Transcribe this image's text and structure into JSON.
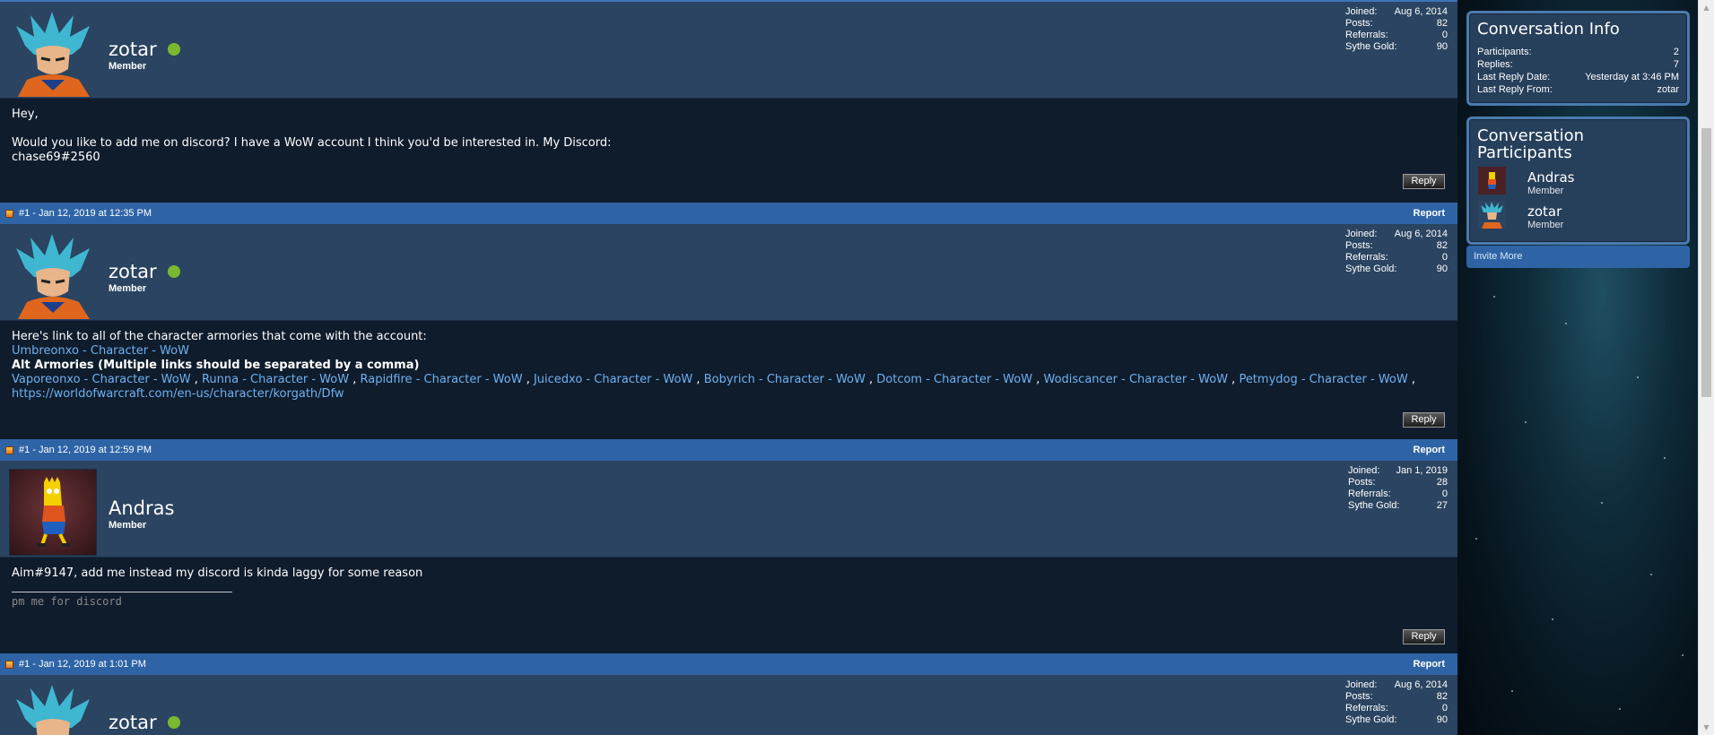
{
  "posts": [
    {
      "header": null,
      "username": "zotar",
      "online": true,
      "usertitle": "Member",
      "avatar": "goku-avatar",
      "stats": [
        {
          "label": "Joined:",
          "value": "Aug 6, 2014"
        },
        {
          "label": "Posts:",
          "value": "82"
        },
        {
          "label": "Referrals:",
          "value": "0"
        },
        {
          "label": "Sythe Gold:",
          "value": "90"
        }
      ],
      "body_lines": [
        "Hey,",
        "",
        "Would you like to add me on discord? I have a WoW account I think you'd be interested in. My Discord:",
        "chase69#2560"
      ],
      "reply_label": "Reply"
    },
    {
      "header": {
        "title": "#1 - Jan 12, 2019 at 12:35 PM",
        "report_label": "Report"
      },
      "username": "zotar",
      "online": true,
      "usertitle": "Member",
      "avatar": "goku-avatar",
      "stats": [
        {
          "label": "Joined:",
          "value": "Aug 6, 2014"
        },
        {
          "label": "Posts:",
          "value": "82"
        },
        {
          "label": "Referrals:",
          "value": "0"
        },
        {
          "label": "Sythe Gold:",
          "value": "90"
        }
      ],
      "intro": "Here's link to all of the character armories that come with the account:",
      "main_link": "Umbreonxo - Character - WoW",
      "alt_heading": "Alt Armories (Multiple links should be separated by a comma)",
      "alt_links": [
        "Vaporeonxo - Character - WoW",
        "Runna - Character - WoW",
        "Rapidfire - Character - WoW",
        "Juicedxo - Character - WoW",
        "Bobyrich - Character - WoW",
        "Dotcom - Character - WoW",
        "Wodiscancer - Character - WoW",
        "Petmydog - Character - WoW",
        "https://worldofwarcraft.com/en-us/character/korgath/Dfw"
      ],
      "separator": " , ",
      "reply_label": "Reply"
    },
    {
      "header": {
        "title": "#1 - Jan 12, 2019 at 12:59 PM",
        "report_label": "Report"
      },
      "username": "Andras",
      "online": false,
      "usertitle": "Member",
      "avatar": "bart-avatar",
      "stats": [
        {
          "label": "Joined:",
          "value": "Jan 1, 2019"
        },
        {
          "label": "Posts:",
          "value": "28"
        },
        {
          "label": "Referrals:",
          "value": "0"
        },
        {
          "label": "Sythe Gold:",
          "value": "27"
        }
      ],
      "body": "Aim#9147, add me instead my discord is kinda laggy for some reason",
      "signature": "pm me for discord",
      "reply_label": "Reply"
    },
    {
      "header": {
        "title": "#1 - Jan 12, 2019 at 1:01 PM",
        "report_label": "Report"
      },
      "username": "zotar",
      "online": true,
      "usertitle": "",
      "avatar": "goku-avatar",
      "stats": [
        {
          "label": "Joined:",
          "value": "Aug 6, 2014"
        },
        {
          "label": "Posts:",
          "value": "82"
        },
        {
          "label": "Referrals:",
          "value": "0"
        },
        {
          "label": "Sythe Gold:",
          "value": "90"
        }
      ]
    }
  ],
  "sidebar": {
    "info_title": "Conversation Info",
    "info_rows": [
      {
        "label": "Participants:",
        "value": "2"
      },
      {
        "label": "Replies:",
        "value": "7"
      },
      {
        "label": "Last Reply Date:",
        "value": "Yesterday at 3:46 PM"
      },
      {
        "label": "Last Reply From:",
        "value": "zotar"
      }
    ],
    "participants_title_line1": "Conversation",
    "participants_title_line2": "Participants",
    "participants": [
      {
        "name": "Andras",
        "role": "Member",
        "avatar": "bart-avatar"
      },
      {
        "name": "zotar",
        "role": "Member",
        "avatar": "goku-avatar"
      }
    ],
    "invite_label": "Invite More"
  },
  "colors": {
    "header_blue": "#2e64a6",
    "userbar": "#2a4461",
    "post_body": "#0f1c2c",
    "link": "#6fb1f0",
    "online": "#7cb82f"
  }
}
